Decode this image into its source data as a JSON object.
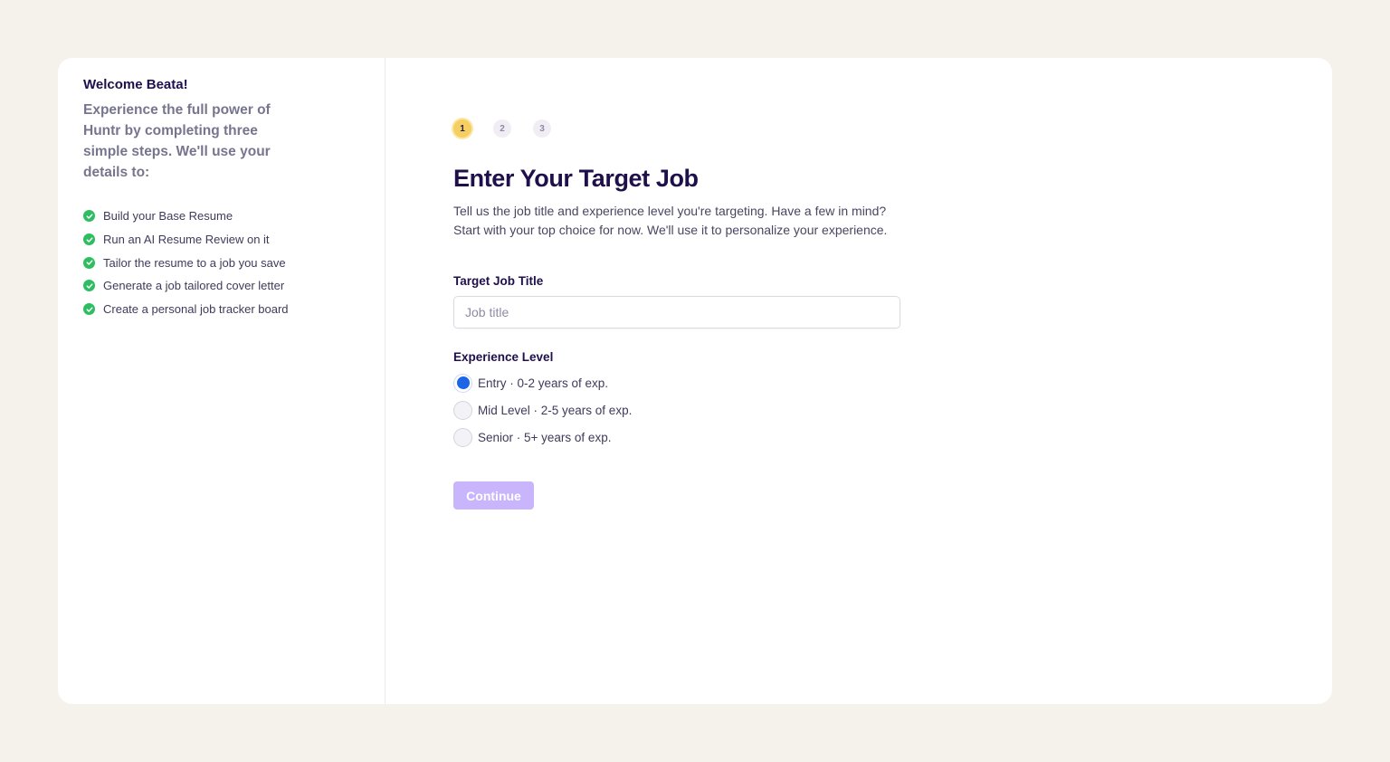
{
  "sidebar": {
    "welcome": "Welcome Beata!",
    "intro": "Experience the full power of Huntr by completing three simple steps. We'll use your details to:",
    "benefits": [
      "Build your Base Resume",
      "Run an AI Resume Review on it",
      "Tailor the resume to a job you save",
      "Generate a job tailored cover letter",
      "Create a personal job tracker board"
    ],
    "check_color": "#2fbd62"
  },
  "steps": [
    "1",
    "2",
    "3"
  ],
  "active_step": 1,
  "main": {
    "title": "Enter Your Target Job",
    "subtitle": "Tell us the job title and experience level you're targeting. Have a few in mind? Start with your top choice for now. We'll use it to personalize your experience.",
    "job_title_label": "Target Job Title",
    "job_title_placeholder": "Job title",
    "job_title_value": "",
    "experience_label": "Experience Level",
    "experience_options": [
      "Entry · 0-2 years of exp.",
      "Mid Level · 2-5 years of exp.",
      "Senior · 5+ years of exp."
    ],
    "selected_experience": 0,
    "continue_label": "Continue"
  },
  "colors": {
    "accent_radio": "#1a66e6",
    "continue_disabled": "#c9b5fb",
    "active_step": "#f6cf62"
  }
}
